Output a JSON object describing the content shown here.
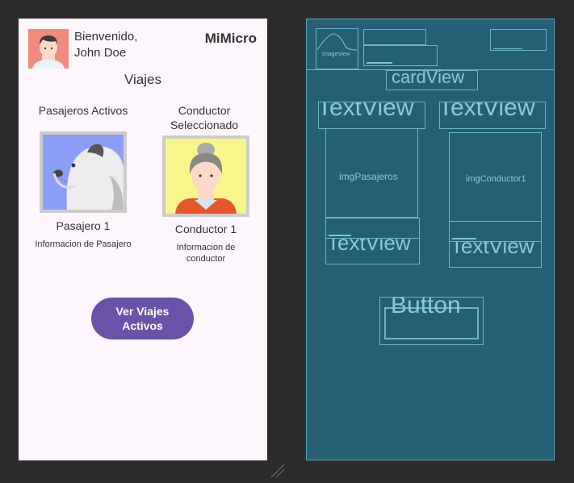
{
  "app": {
    "welcome_line1": "Bienvenido,",
    "welcome_line2": "John Doe",
    "brand": "MiMicro",
    "section_title": "Viajes"
  },
  "passengers": {
    "title": "Pasajeros Activos",
    "name": "Pasajero 1",
    "info": "Informacion de Pasajero"
  },
  "driver": {
    "title": "Conductor Seleccionado",
    "name": "Conductor 1",
    "info": "Informacion de conductor"
  },
  "action": {
    "button_label": "Ver Viajes Activos"
  },
  "blueprint": {
    "image_view": "ImageView",
    "card_view": "cardView",
    "text_view": "TextView",
    "img_passengers": "imgPasajeros",
    "img_driver": "imgConductor1",
    "button": "Button"
  },
  "colors": {
    "accent": "#6a52a8",
    "avatar_bg": "#f08b7e",
    "passenger_bg": "#8a9ef5",
    "driver_bg": "#f8f58a",
    "blueprint_bg": "#245f73"
  }
}
